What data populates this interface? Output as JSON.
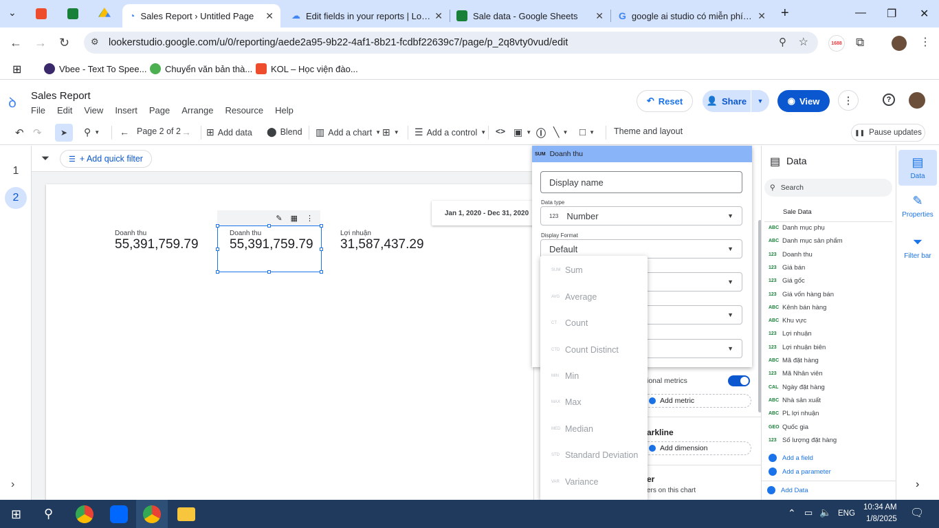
{
  "browser": {
    "tabs": [
      {
        "title": "Sales Report › Untitled Page",
        "active": true
      },
      {
        "title": "Edit fields in your reports | Looker",
        "active": false
      },
      {
        "title": "Sale data - Google Sheets",
        "active": false
      },
      {
        "title": "google ai studio có miễn phí không",
        "active": false
      }
    ],
    "url": "lookerstudio.google.com/u/0/reporting/aede2a95-9b22-4af1-8b21-fcdbf22639c7/page/p_2q8vty0vud/edit",
    "bookmarks": [
      "Vbee - Text To Spee...",
      "Chuyển văn bản thà...",
      "KOL – Học viện đào..."
    ],
    "ext_badge": "1688"
  },
  "app": {
    "title": "Sales Report",
    "menu": [
      "File",
      "Edit",
      "View",
      "Insert",
      "Page",
      "Arrange",
      "Resource",
      "Help"
    ],
    "reset_label": "Reset",
    "share_label": "Share",
    "view_label": "View"
  },
  "toolbar": {
    "page_indicator": "Page 2 of 2",
    "add_data": "Add data",
    "blend": "Blend",
    "add_chart": "Add a chart",
    "add_control": "Add a control",
    "theme": "Theme and layout",
    "pause": "Pause updates"
  },
  "pages": [
    "1",
    "2"
  ],
  "filter": {
    "add_quick_filter": "+ Add quick filter"
  },
  "date_range": "Jan 1, 2020 - Dec 31, 2020",
  "scorecards": [
    {
      "label": "Doanh thu",
      "value": "55,391,759.79"
    },
    {
      "label": "Doanh thu",
      "value": "55,391,759.79"
    },
    {
      "label": "Lợi nhuận",
      "value": "31,587,437.29"
    }
  ],
  "field_editor": {
    "agg_badge": "SUM",
    "field_name": "Doanh thu",
    "display_name_placeholder": "Display name",
    "data_type_label": "Data type",
    "data_type_value": "Number",
    "data_type_icon": "123",
    "display_format_label": "Display Format",
    "display_format_value": "Default"
  },
  "aggregations": [
    {
      "abbr": "SUM",
      "label": "Sum"
    },
    {
      "abbr": "AVG",
      "label": "Average"
    },
    {
      "abbr": "CT",
      "label": "Count"
    },
    {
      "abbr": "CTD",
      "label": "Count Distinct"
    },
    {
      "abbr": "MIN",
      "label": "Min"
    },
    {
      "abbr": "MAX",
      "label": "Max"
    },
    {
      "abbr": "MED",
      "label": "Median"
    },
    {
      "abbr": "STD",
      "label": "Standard Deviation"
    },
    {
      "abbr": "VAR",
      "label": "Variance"
    }
  ],
  "props": {
    "optional_metrics": "ional metrics",
    "add_metric": "Add metric",
    "sparkline": "arkline",
    "add_dimension": "Add dimension",
    "filter_heading": "er",
    "filter_sub": "ers on this chart"
  },
  "data_panel": {
    "title": "Data",
    "search_placeholder": "Search",
    "source": "Sale Data",
    "fields": [
      {
        "type": "ABC",
        "name": "Danh mục phụ"
      },
      {
        "type": "ABC",
        "name": "Danh mục sản phẩm"
      },
      {
        "type": "123",
        "name": "Doanh thu"
      },
      {
        "type": "123",
        "name": "Giá bán"
      },
      {
        "type": "123",
        "name": "Giá gốc"
      },
      {
        "type": "123",
        "name": "Giá vốn hàng bán"
      },
      {
        "type": "ABC",
        "name": "Kênh bán hàng"
      },
      {
        "type": "ABC",
        "name": "Khu vực"
      },
      {
        "type": "123",
        "name": "Lợi nhuận"
      },
      {
        "type": "123",
        "name": "Lợi nhuận biên"
      },
      {
        "type": "ABC",
        "name": "Mã đặt hàng"
      },
      {
        "type": "123",
        "name": "Mã Nhân viên"
      },
      {
        "type": "CAL",
        "name": "Ngày đặt hàng"
      },
      {
        "type": "ABC",
        "name": "Nhà sản xuất"
      },
      {
        "type": "ABC",
        "name": "PL lợi nhuận"
      },
      {
        "type": "GEO",
        "name": "Quốc gia"
      },
      {
        "type": "123",
        "name": "Số lượng đặt hàng"
      }
    ],
    "add_field": "Add a field",
    "add_parameter": "Add a parameter",
    "add_data": "Add Data"
  },
  "side_tabs": [
    "Data",
    "Properties",
    "Filter bar"
  ],
  "taskbar": {
    "lang": "ENG",
    "time": "10:34 AM",
    "date": "1/8/2025"
  }
}
